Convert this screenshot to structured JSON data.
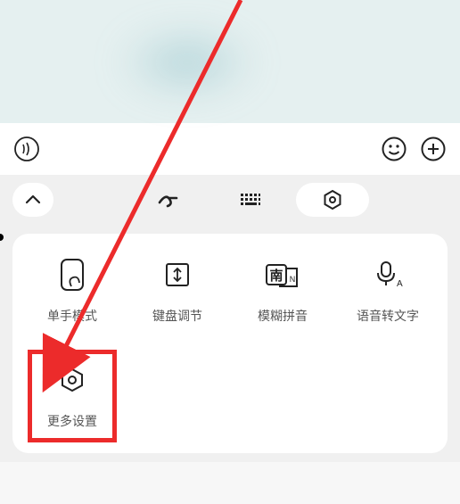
{
  "grid": {
    "items": [
      {
        "label": "单手模式",
        "name": "one-hand-mode"
      },
      {
        "label": "键盘调节",
        "name": "keyboard-adjust"
      },
      {
        "label": "模糊拼音",
        "name": "fuzzy-pinyin"
      },
      {
        "label": "语音转文字",
        "name": "voice-to-text"
      },
      {
        "label": "更多设置",
        "name": "more-settings"
      }
    ]
  },
  "tabs": {
    "items": [
      "handwriting",
      "keyboard",
      "settings"
    ],
    "active_index": 2
  },
  "annotation": {
    "highlight_color": "#ec2b2b",
    "target": "more-settings"
  }
}
